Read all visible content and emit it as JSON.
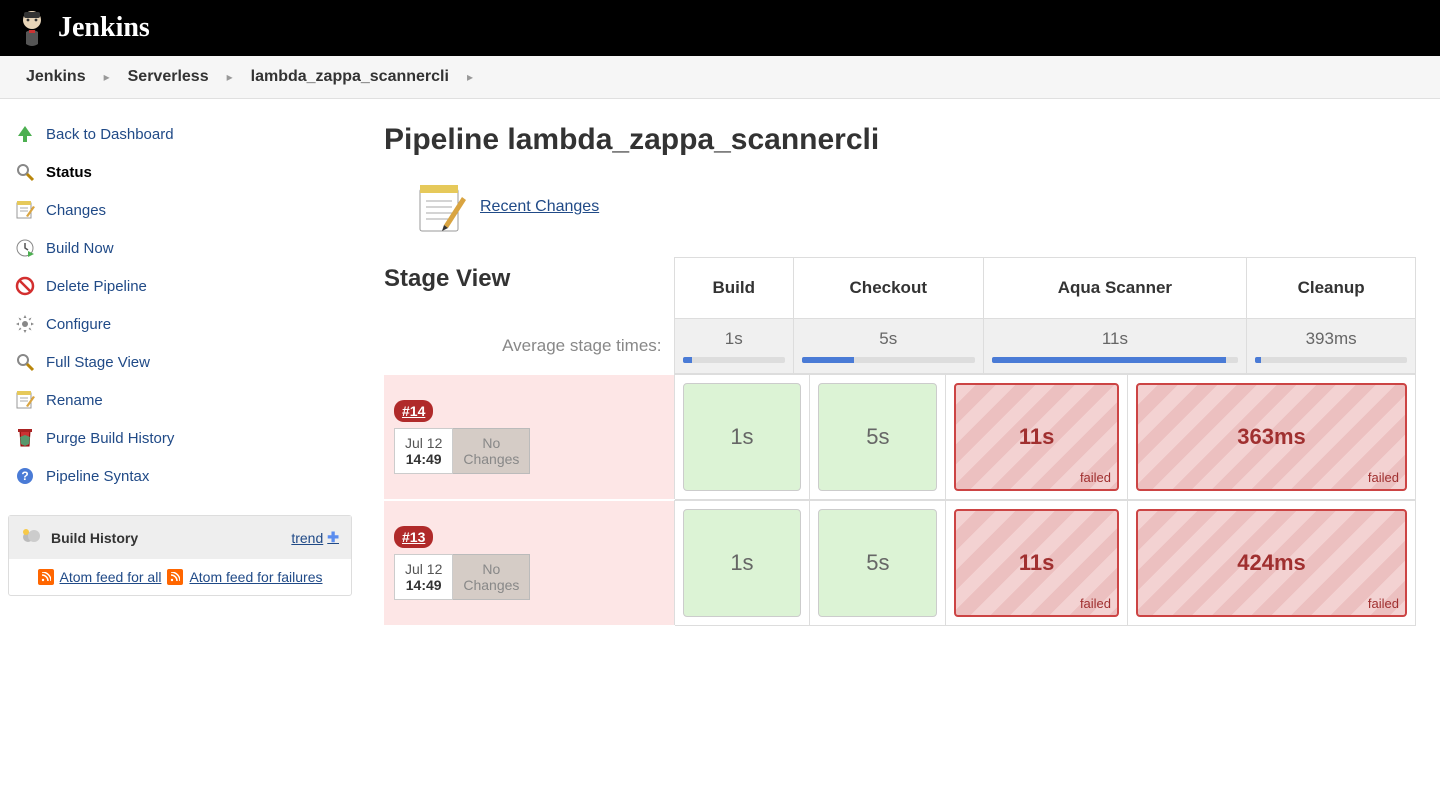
{
  "header": {
    "product": "Jenkins"
  },
  "breadcrumbs": [
    "Jenkins",
    "Serverless",
    "lambda_zappa_scannercli"
  ],
  "sidebar": {
    "items": [
      {
        "label": "Back to Dashboard",
        "icon": "arrow-up"
      },
      {
        "label": "Status",
        "icon": "search",
        "active": true
      },
      {
        "label": "Changes",
        "icon": "notepad"
      },
      {
        "label": "Build Now",
        "icon": "clock-play"
      },
      {
        "label": "Delete Pipeline",
        "icon": "no-entry"
      },
      {
        "label": "Configure",
        "icon": "gear"
      },
      {
        "label": "Full Stage View",
        "icon": "search"
      },
      {
        "label": "Rename",
        "icon": "notepad"
      },
      {
        "label": "Purge Build History",
        "icon": "trash-shield"
      },
      {
        "label": "Pipeline Syntax",
        "icon": "help"
      }
    ]
  },
  "build_history": {
    "title": "Build History",
    "trend_label": "trend",
    "feed_all": "Atom feed for all",
    "feed_fail": "Atom feed for failures"
  },
  "page": {
    "title": "Pipeline lambda_zappa_scannercli",
    "recent_changes": "Recent Changes",
    "stage_view": "Stage View",
    "avg_label": "Average stage times:"
  },
  "stages": [
    "Build",
    "Checkout",
    "Aqua Scanner",
    "Cleanup"
  ],
  "avg_times": [
    {
      "text": "1s",
      "pct": 9
    },
    {
      "text": "5s",
      "pct": 30
    },
    {
      "text": "11s",
      "pct": 95
    },
    {
      "text": "393ms",
      "pct": 4
    }
  ],
  "builds": [
    {
      "id": "#14",
      "date": "Jul 12",
      "time": "14:49",
      "changes": "No Changes",
      "cells": [
        {
          "text": "1s",
          "status": "ok"
        },
        {
          "text": "5s",
          "status": "ok"
        },
        {
          "text": "11s",
          "status": "failed"
        },
        {
          "text": "363ms",
          "status": "failed"
        }
      ]
    },
    {
      "id": "#13",
      "date": "Jul 12",
      "time": "14:49",
      "changes": "No Changes",
      "cells": [
        {
          "text": "1s",
          "status": "ok"
        },
        {
          "text": "5s",
          "status": "ok"
        },
        {
          "text": "11s",
          "status": "failed"
        },
        {
          "text": "424ms",
          "status": "failed"
        }
      ]
    }
  ],
  "labels": {
    "failed": "failed"
  }
}
